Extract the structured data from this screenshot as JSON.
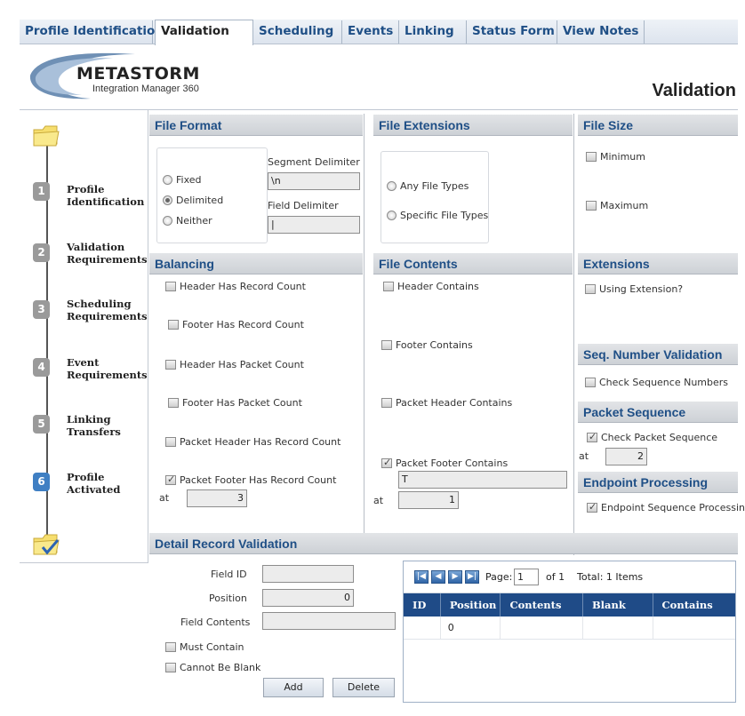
{
  "tabs": [
    "Profile Identification",
    "Validation",
    "Scheduling",
    "Events",
    "Linking",
    "Status Form",
    "View Notes"
  ],
  "logo": {
    "brand": "METASTORM",
    "suffix": "·",
    "subtitle": "Integration Manager 360"
  },
  "page_title": "Validation",
  "steps": [
    {
      "num": "1",
      "label": "Profile Identification"
    },
    {
      "num": "2",
      "label": "Validation Requirements"
    },
    {
      "num": "3",
      "label": "Scheduling Requirements"
    },
    {
      "num": "4",
      "label": "Event Requirements"
    },
    {
      "num": "5",
      "label": "Linking Transfers"
    },
    {
      "num": "6",
      "label": "Profile Activated"
    }
  ],
  "file_format": {
    "title": "File Format",
    "options": [
      "Fixed",
      "Delimited",
      "Neither"
    ],
    "selected": "Delimited",
    "segment_label": "Segment Delimiter",
    "segment_value": "\\n",
    "field_label": "Field Delimiter",
    "field_value": "|"
  },
  "file_extensions": {
    "title": "File Extensions",
    "options": [
      "Any File Types",
      "Specific File Types"
    ]
  },
  "file_size": {
    "title": "File Size",
    "min": "Minimum",
    "max": "Maximum"
  },
  "balancing": {
    "title": "Balancing",
    "items": [
      "Header Has Record Count",
      "Footer Has Record Count",
      "Header Has Packet Count",
      "Footer Has Packet Count",
      "Packet Header Has Record Count",
      "Packet Footer Has Record Count"
    ],
    "at_label": "at",
    "at_value": "3"
  },
  "file_contents": {
    "title": "File Contents",
    "items": [
      "Header Contains",
      "Footer Contains",
      "Packet Header Contains",
      "Packet Footer Contains"
    ],
    "packet_footer_value": "T",
    "at_label": "at",
    "at_value": "1"
  },
  "extensions": {
    "title": "Extensions",
    "item": "Using Extension?"
  },
  "seq_number": {
    "title": "Seq. Number Validation",
    "item": "Check Sequence Numbers"
  },
  "packet_sequence": {
    "title": "Packet Sequence",
    "item": "Check Packet Sequence",
    "at_label": "at",
    "at_value": "2"
  },
  "endpoint": {
    "title": "Endpoint Processing",
    "item": "Endpoint Sequence Processing"
  },
  "detail": {
    "title": "Detail Record Validation",
    "field_id_label": "Field ID",
    "field_id_value": "",
    "position_label": "Position",
    "position_value": "0",
    "contents_label": "Field Contents",
    "contents_value": "",
    "must_contain": "Must Contain",
    "cannot_blank": "Cannot Be Blank",
    "add": "Add",
    "delete": "Delete"
  },
  "grid": {
    "page_label": "Page:",
    "page_value": "1",
    "of_label": "of 1",
    "total": "Total: 1 Items",
    "columns": [
      "ID",
      "Position",
      "Contents",
      "Blank",
      "Contains"
    ],
    "rows": [
      [
        "",
        "0",
        "",
        "",
        ""
      ]
    ]
  },
  "colors": {
    "accent": "#1f4f86",
    "grid_header": "#1f4b87",
    "step_active": "#3f7fc3"
  }
}
